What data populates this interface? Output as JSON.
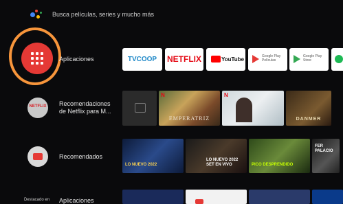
{
  "search": {
    "placeholder": "Busca películas, series y mucho más"
  },
  "rows": {
    "apps": {
      "label": "Aplicaciones"
    },
    "netflix": {
      "label_line1": "Recomendaciones",
      "label_line2": "de Netflix para  M...",
      "icon_text": "NETFLIX"
    },
    "recommended": {
      "label": "Recomendados"
    }
  },
  "apps": [
    {
      "name": "TVCOOP",
      "sub": ""
    },
    {
      "name": "NETFLIX",
      "sub": ""
    },
    {
      "name": "YouTube",
      "sub": ""
    },
    {
      "name": "Google Play",
      "sub": "Películas"
    },
    {
      "name": "Google Play",
      "sub": "Store"
    }
  ],
  "netflix_thumbs": [
    {
      "caption": ""
    },
    {
      "caption": "EMPERATRIZ"
    },
    {
      "caption": ""
    },
    {
      "caption": "DANMER"
    }
  ],
  "recommended_thumbs": [
    {
      "caption": "LO NUEVO 2022"
    },
    {
      "caption": "LO NUEVO 2022 SET EN VIVO"
    },
    {
      "caption": "PICO DESPRENDIDO"
    },
    {
      "caption": "FER PALACIO"
    }
  ],
  "bottom": {
    "featured": "Destacado en",
    "label": "Aplicaciones"
  },
  "colors": {
    "focus_ring": "#f7953b",
    "apps_red": "#e53935",
    "netflix_red": "#e50914"
  }
}
